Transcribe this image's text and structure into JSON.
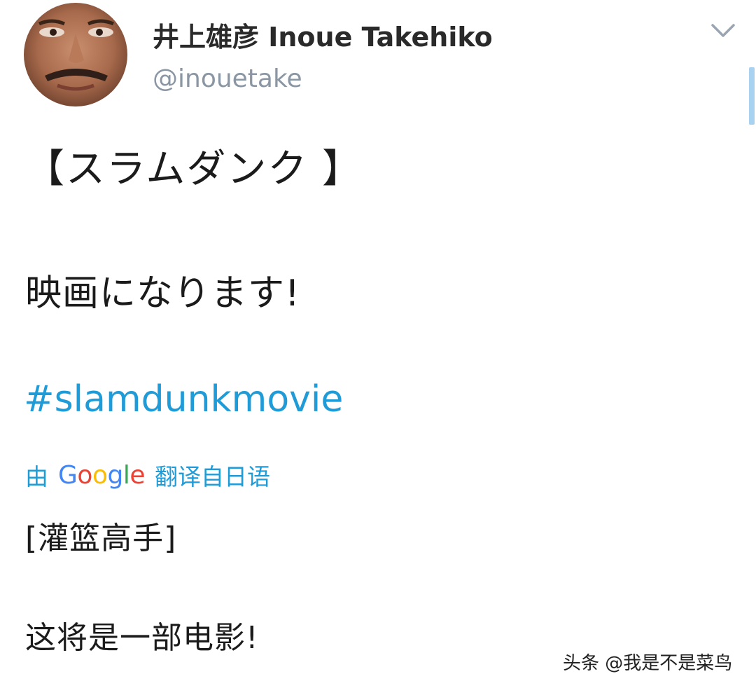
{
  "profile": {
    "display_name": "井上雄彦 Inoue Takehiko",
    "handle": "@inouetake"
  },
  "header": {
    "menu_icon": "chevron-down-icon"
  },
  "tweet": {
    "title": "【スラムダンク 】",
    "line": "映画になります!",
    "hashtag": "#slamdunkmovie"
  },
  "translation": {
    "prefix": "由",
    "provider": [
      "G",
      "o",
      "o",
      "g",
      "l",
      "e"
    ],
    "suffix": "翻译自日语",
    "title": "[灌篮高手]",
    "line": "这将是一部电影!"
  },
  "watermark": "头条 @我是不是菜鸟",
  "colors": {
    "link": "#1f9bd7",
    "handle": "#8a96a3",
    "scrollbar": "#a8d2ef"
  }
}
